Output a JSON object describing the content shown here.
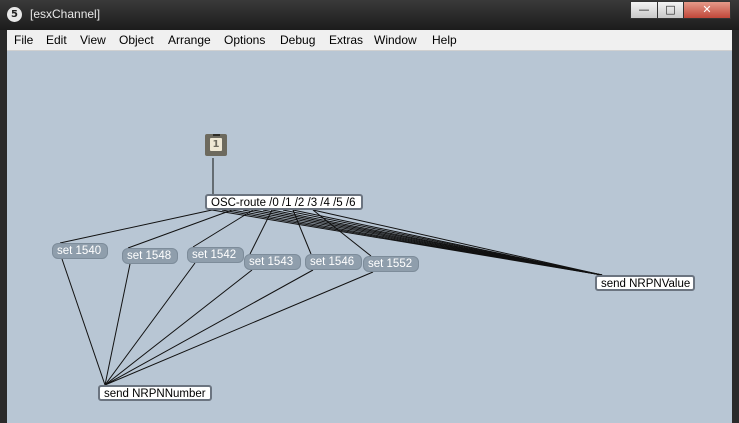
{
  "window": {
    "app_badge": "5",
    "title": "[esxChannel]",
    "controls": {
      "minimize": "—",
      "maximize": "□",
      "close": "✕"
    }
  },
  "menu": [
    "File",
    "Edit",
    "View",
    "Object",
    "Arrange",
    "Options",
    "Debug",
    "Extras",
    "Window",
    "Help"
  ],
  "patch": {
    "inlet_number": "1",
    "route_object": "OSC-route /0 /1 /2 /3 /4 /5 /6",
    "messages": [
      "set 1540",
      "set 1548",
      "set 1542",
      "set 1543",
      "set 1546",
      "set 1552"
    ],
    "send_value": "send NRPNValue",
    "send_number": "send NRPNNumber"
  }
}
